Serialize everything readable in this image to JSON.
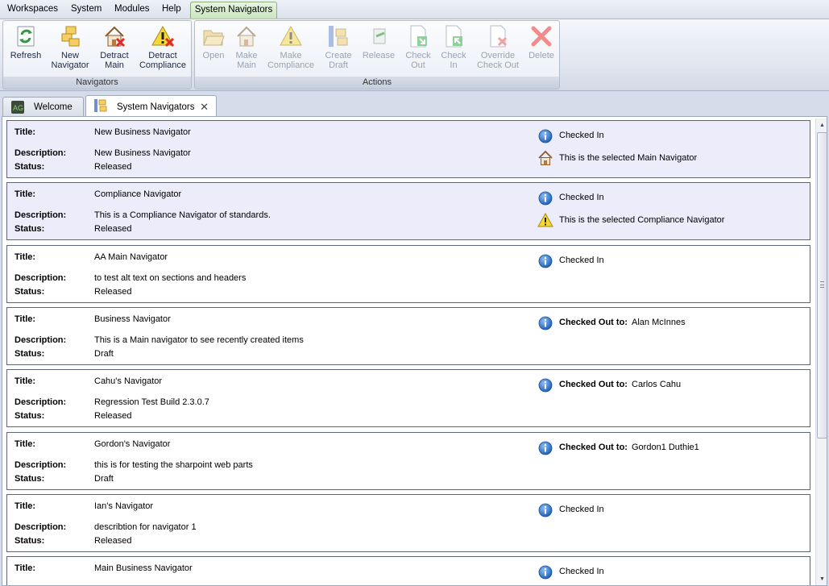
{
  "menu": {
    "items": [
      "Workspaces",
      "System",
      "Modules",
      "Help"
    ],
    "active_tab": "System Navigators"
  },
  "ribbon": {
    "navigators_group": {
      "label": "Navigators",
      "buttons": [
        {
          "label": "Refresh",
          "icon": "refresh-icon"
        },
        {
          "label": "New\nNavigator",
          "icon": "new-navigator-icon"
        },
        {
          "label": "Detract\nMain",
          "icon": "detract-main-icon"
        },
        {
          "label": "Detract\nCompliance",
          "icon": "detract-compliance-icon"
        }
      ]
    },
    "actions_group": {
      "label": "Actions",
      "buttons": [
        {
          "label": "Open",
          "icon": "open-folder-icon",
          "disabled": true
        },
        {
          "label": "Make\nMain",
          "icon": "make-main-icon",
          "disabled": true
        },
        {
          "label": "Make\nCompliance",
          "icon": "make-compliance-icon",
          "disabled": true
        },
        {
          "label": "Create\nDraft",
          "icon": "create-draft-icon",
          "disabled": true
        },
        {
          "label": "Release",
          "icon": "release-icon",
          "disabled": true
        },
        {
          "label": "Check\nOut",
          "icon": "check-out-icon",
          "disabled": true
        },
        {
          "label": "Check\nIn",
          "icon": "check-in-icon",
          "disabled": true
        },
        {
          "label": "Override\nCheck Out",
          "icon": "override-check-out-icon",
          "disabled": true
        },
        {
          "label": "Delete",
          "icon": "delete-icon",
          "disabled": true
        }
      ]
    }
  },
  "tabs": [
    {
      "label": "Welcome",
      "icon": "welcome-app-icon"
    },
    {
      "label": "System Navigators",
      "icon": "navigator-icon",
      "close": "✕"
    }
  ],
  "labels": {
    "title": "Title:",
    "description": "Description:",
    "status": "Status:",
    "checked_out_to": "Checked Out to:"
  },
  "navigators": [
    {
      "title": "New Business Navigator",
      "description": "New Business Navigator",
      "status": "Released",
      "check_state": "Checked In",
      "checked_out_to": "",
      "selected": true,
      "selection_text": "This is the selected Main Navigator",
      "selection_icon": "home-icon"
    },
    {
      "title": "Compliance Navigator",
      "description": "This is a Compliance Navigator of standards.",
      "status": "Released",
      "check_state": "Checked In",
      "checked_out_to": "",
      "selected": true,
      "selection_text": "This is the selected Compliance Navigator",
      "selection_icon": "warning-icon"
    },
    {
      "title": "AA Main Navigator",
      "description": "to test alt text on sections and headers",
      "status": "Released",
      "check_state": "Checked In",
      "checked_out_to": "",
      "selected": false,
      "selection_text": "",
      "selection_icon": ""
    },
    {
      "title": "Business Navigator",
      "description": "This is a Main navigator to see recently created items",
      "status": "Draft",
      "check_state": "",
      "checked_out_to": "Alan McInnes",
      "selected": false,
      "selection_text": "",
      "selection_icon": ""
    },
    {
      "title": "Cahu's Navigator",
      "description": "Regression Test Build 2.3.0.7",
      "status": "Released",
      "check_state": "",
      "checked_out_to": "Carlos Cahu",
      "selected": false,
      "selection_text": "",
      "selection_icon": ""
    },
    {
      "title": "Gordon's Navigator",
      "description": "this is for testing the sharpoint web parts",
      "status": "Draft",
      "check_state": "",
      "checked_out_to": "Gordon1 Duthie1",
      "selected": false,
      "selection_text": "",
      "selection_icon": ""
    },
    {
      "title": "Ian's Navigator",
      "description": "describtion for navigator 1",
      "status": "Released",
      "check_state": "Checked In",
      "checked_out_to": "",
      "selected": false,
      "selection_text": "",
      "selection_icon": ""
    },
    {
      "title": "Main Business Navigator",
      "description": "",
      "status": "",
      "check_state": "Checked In",
      "checked_out_to": "",
      "selected": false,
      "selection_text": "",
      "selection_icon": ""
    }
  ],
  "colors": {
    "selected_card": "#ececfb",
    "card_border": "#5e6675",
    "ribbon_tab_active": "#c6e4bb"
  }
}
